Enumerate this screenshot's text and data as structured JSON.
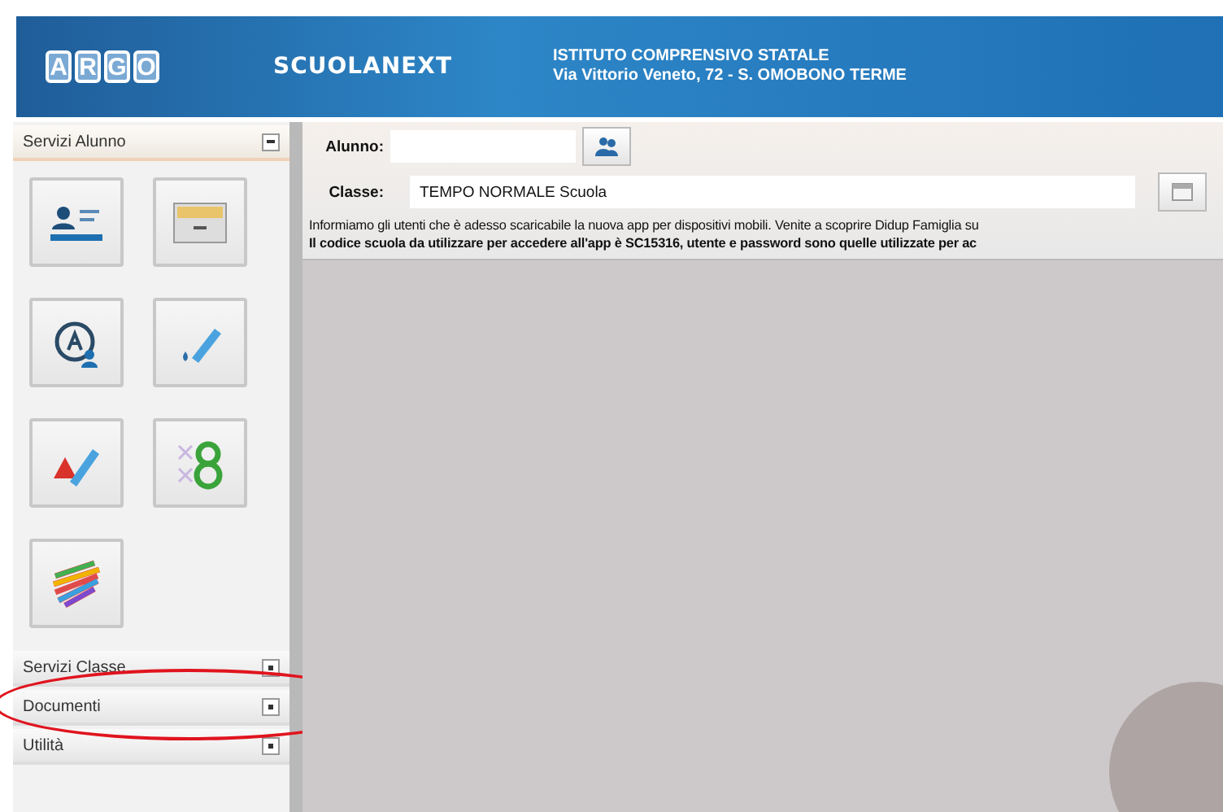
{
  "header": {
    "logo_letters": [
      "A",
      "R",
      "G",
      "O"
    ],
    "product": "SCUOLANEXT",
    "school_name": "ISTITUTO COMPRENSIVO STATALE",
    "school_address": "Via Vittorio Veneto, 72 - S. OMOBONO TERME"
  },
  "sidebar": {
    "sections": [
      {
        "title": "Servizi Alunno",
        "expanded": true,
        "tiles": [
          {
            "kind": "id-card"
          },
          {
            "kind": "drawer"
          },
          {
            "kind": "grade-person"
          },
          {
            "kind": "pencil-drop"
          },
          {
            "kind": "warning-pencil"
          },
          {
            "kind": "number-eight"
          },
          {
            "kind": "colors"
          }
        ]
      },
      {
        "title": "Servizi Classe",
        "expanded": false,
        "highlighted": false
      },
      {
        "title": "Documenti",
        "expanded": false,
        "highlighted": true
      },
      {
        "title": "Utilità",
        "expanded": false,
        "highlighted": false
      }
    ]
  },
  "form": {
    "student_label": "Alunno:",
    "class_label": "Classe:",
    "class_value": "TEMPO NORMALE Scuola",
    "notices": [
      {
        "text": "Informiamo gli utenti che è adesso scaricabile la nuova app per dispositivi mobili. Venite a scoprire Didup Famiglia su",
        "bold": false
      },
      {
        "text": "Il codice scuola da utilizzare per accedere all'app è SC15316, utente e password sono quelle utilizzate per ac",
        "bold": true
      }
    ]
  }
}
